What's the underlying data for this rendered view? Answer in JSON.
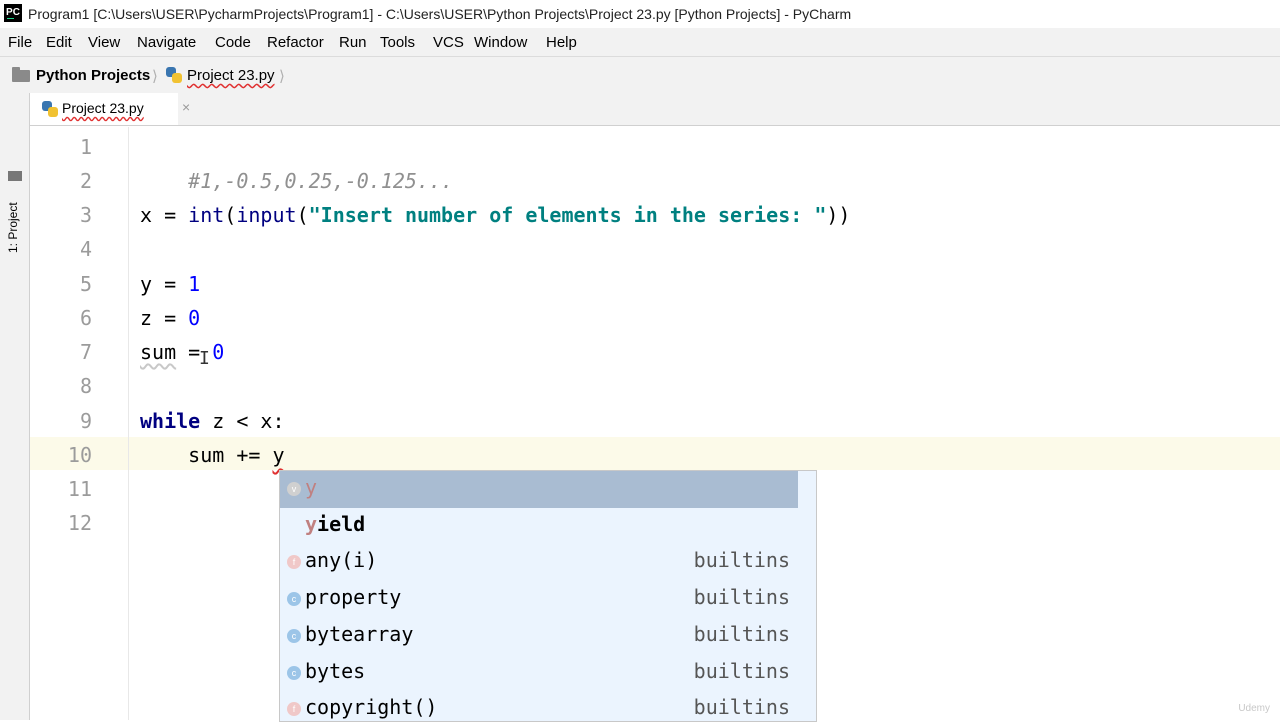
{
  "window": {
    "title": "Program1 [C:\\Users\\USER\\PycharmProjects\\Program1] - C:\\Users\\USER\\Python Projects\\Project 23.py [Python Projects] - PyCharm",
    "icon_text": "PC"
  },
  "menu": {
    "items": [
      "File",
      "Edit",
      "View",
      "Navigate",
      "Code",
      "Refactor",
      "Run",
      "Tools",
      "VCS",
      "Window",
      "Help"
    ]
  },
  "breadcrumb": {
    "project": "Python Projects",
    "file": "Project 23.py",
    "separator": "⟩"
  },
  "sidebar": {
    "tool_window": "1: Project"
  },
  "tabs": [
    {
      "label": "Project 23.py",
      "close": "×"
    }
  ],
  "editor": {
    "line_numbers": [
      "1",
      "2",
      "3",
      "4",
      "5",
      "6",
      "7",
      "8",
      "9",
      "10",
      "11",
      "12"
    ],
    "current_line": 10,
    "lines": {
      "l1": {
        "comment": "#1,-0.5,0.25,-0.125..."
      },
      "l3": {
        "var": "x",
        "eq": " = ",
        "int": "int",
        "open1": "(",
        "input": "input",
        "open2": "(",
        "str": "\"Insert number of elements in the series: \"",
        "close": "))"
      },
      "l5": {
        "var": "y",
        "eq": " = ",
        "num": "1"
      },
      "l6": {
        "var": "z",
        "eq": " = ",
        "num": "0"
      },
      "l7": {
        "var": "sum",
        "eq": " = ",
        "num": "0"
      },
      "l9": {
        "kw": "while",
        "rest": " z < x:"
      },
      "l10": {
        "indent": "    ",
        "var": "sum",
        "op": " += ",
        "typed": "y"
      }
    }
  },
  "autocomplete": {
    "items": [
      {
        "icon": "variable-icon",
        "icon_letter": "v",
        "icon_color": "#d0d0d0",
        "match": "y",
        "rest": "",
        "type": "",
        "bold": false
      },
      {
        "icon": "",
        "icon_letter": "",
        "icon_color": "",
        "match": "y",
        "rest": "ield",
        "type": "",
        "bold": true
      },
      {
        "icon": "function-icon",
        "icon_letter": "f",
        "icon_color": "#f0c8c8",
        "match": "",
        "rest": "any(i)",
        "type": "builtins",
        "bold": false
      },
      {
        "icon": "class-icon",
        "icon_letter": "c",
        "icon_color": "#9cc5e8",
        "match": "",
        "rest": "property",
        "type": "builtins",
        "bold": false
      },
      {
        "icon": "class-icon",
        "icon_letter": "c",
        "icon_color": "#9cc5e8",
        "match": "",
        "rest": "bytearray",
        "type": "builtins",
        "bold": false
      },
      {
        "icon": "class-icon",
        "icon_letter": "c",
        "icon_color": "#9cc5e8",
        "match": "",
        "rest": "bytes",
        "type": "builtins",
        "bold": false
      },
      {
        "icon": "function-icon",
        "icon_letter": "f",
        "icon_color": "#f0c8c8",
        "match": "",
        "rest": "copyright()",
        "type": "builtins",
        "bold": false
      }
    ]
  },
  "watermark": {
    "text": "Udemy"
  }
}
